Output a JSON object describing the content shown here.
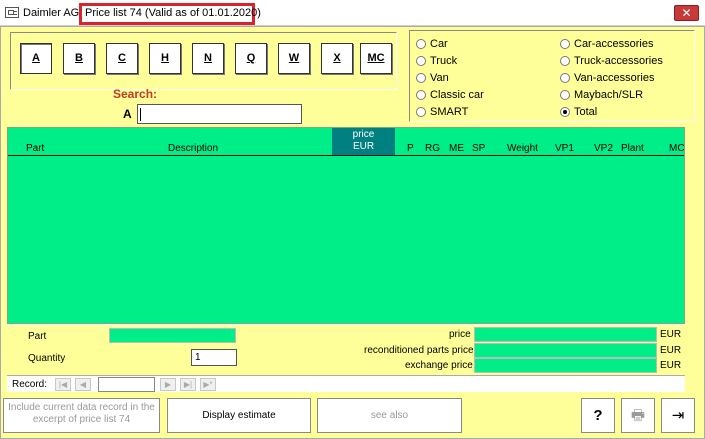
{
  "window": {
    "app_name": "Daimler AG",
    "title": "Price list 74 (Valid as of 01.01.2020)",
    "close_glyph": "✕"
  },
  "letters": [
    "A",
    "B",
    "C",
    "H",
    "N",
    "Q",
    "W",
    "X",
    "MC"
  ],
  "search": {
    "label": "Search:",
    "prefix": "A",
    "value": ""
  },
  "categories": {
    "left": [
      "Car",
      "Truck",
      "Van",
      "Classic car",
      "SMART"
    ],
    "right": [
      "Car-accessories",
      "Truck-accessories",
      "Van-accessories",
      "Maybach/SLR",
      "Total"
    ],
    "selected": "Total"
  },
  "table": {
    "price_header_line1": "price",
    "price_header_line2": "EUR",
    "columns": [
      "Part",
      "Description",
      "P",
      "RG",
      "ME",
      "SP",
      "Weight",
      "VP1",
      "VP2",
      "Plant",
      "MC"
    ]
  },
  "details": {
    "part_label": "Part",
    "quantity_label": "Quantity",
    "quantity_value": "1",
    "price_label": "price",
    "recond_label": "reconditioned parts price",
    "exchange_label": "exchange price",
    "currency": "EUR"
  },
  "record_nav": {
    "label": "Record:",
    "first": "|◀",
    "prev": "◀",
    "next": "▶",
    "last": "▶|",
    "new": "▶*"
  },
  "actions": {
    "include_label": "Include current data record in the excerpt of price list 74",
    "estimate_label": "Display estimate",
    "see_also_label": "see also",
    "help_glyph": "?",
    "print_glyph": "🖶",
    "exit_glyph": "⇥"
  },
  "colors": {
    "form_bg": "#ffff99",
    "grid_bg": "#00ee88",
    "price_header_bg": "#008080",
    "search_label": "#c0392b",
    "highlight": "#d9232d"
  }
}
